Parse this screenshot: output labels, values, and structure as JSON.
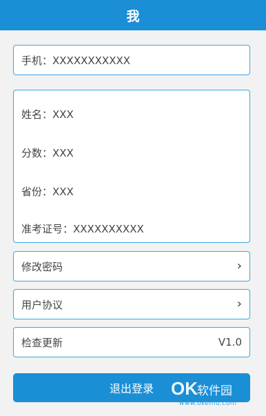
{
  "header": {
    "title": "我"
  },
  "phone": {
    "text": "手机：XXXXXXXXXXX"
  },
  "info": {
    "name": "姓名：XXX",
    "score": "分数：XXX",
    "province": "省份：XXX",
    "ticket": "准考证号：XXXXXXXXXX"
  },
  "menu": {
    "change_password": "修改密码",
    "user_agreement": "用户协议",
    "check_update": "检查更新",
    "version": "V1.0"
  },
  "logout": {
    "label": "退出登录"
  },
  "watermark": {
    "brand": "OK",
    "name": "软件园",
    "url": "www.okemu.com"
  },
  "colors": {
    "primary": "#1a8fd6",
    "border": "#39a6e3",
    "background": "#f2f2f2"
  },
  "icons": {
    "chevron": "chevron-right-icon"
  }
}
